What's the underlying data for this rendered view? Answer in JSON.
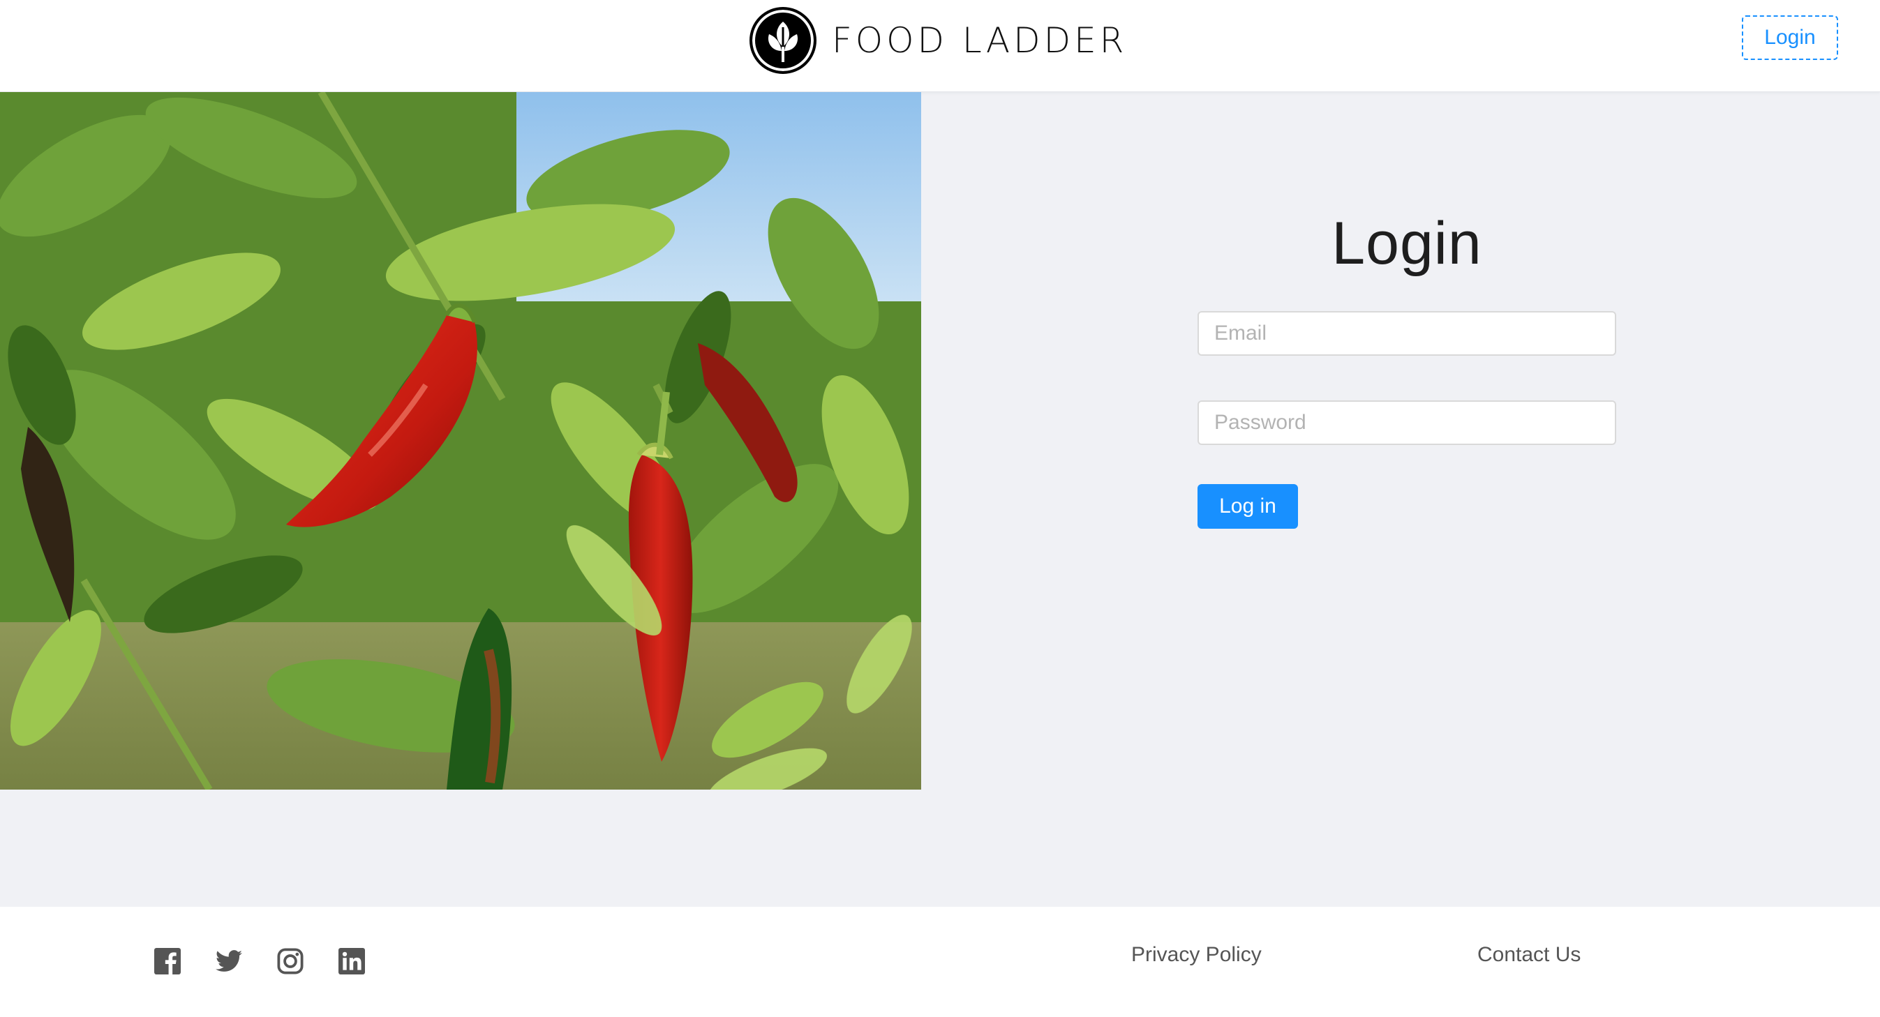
{
  "header": {
    "brand_name": "FOOD LADDER",
    "login_label": "Login"
  },
  "login_form": {
    "title": "Login",
    "email_placeholder": "Email",
    "password_placeholder": "Password",
    "submit_label": "Log in"
  },
  "footer": {
    "social_icons": [
      "facebook-icon",
      "twitter-icon",
      "instagram-icon",
      "linkedin-icon"
    ],
    "privacy_label": "Privacy Policy",
    "contact_label": "Contact Us"
  },
  "colors": {
    "accent": "#1890ff",
    "background": "#f0f1f5",
    "icon_gray": "#555555"
  }
}
